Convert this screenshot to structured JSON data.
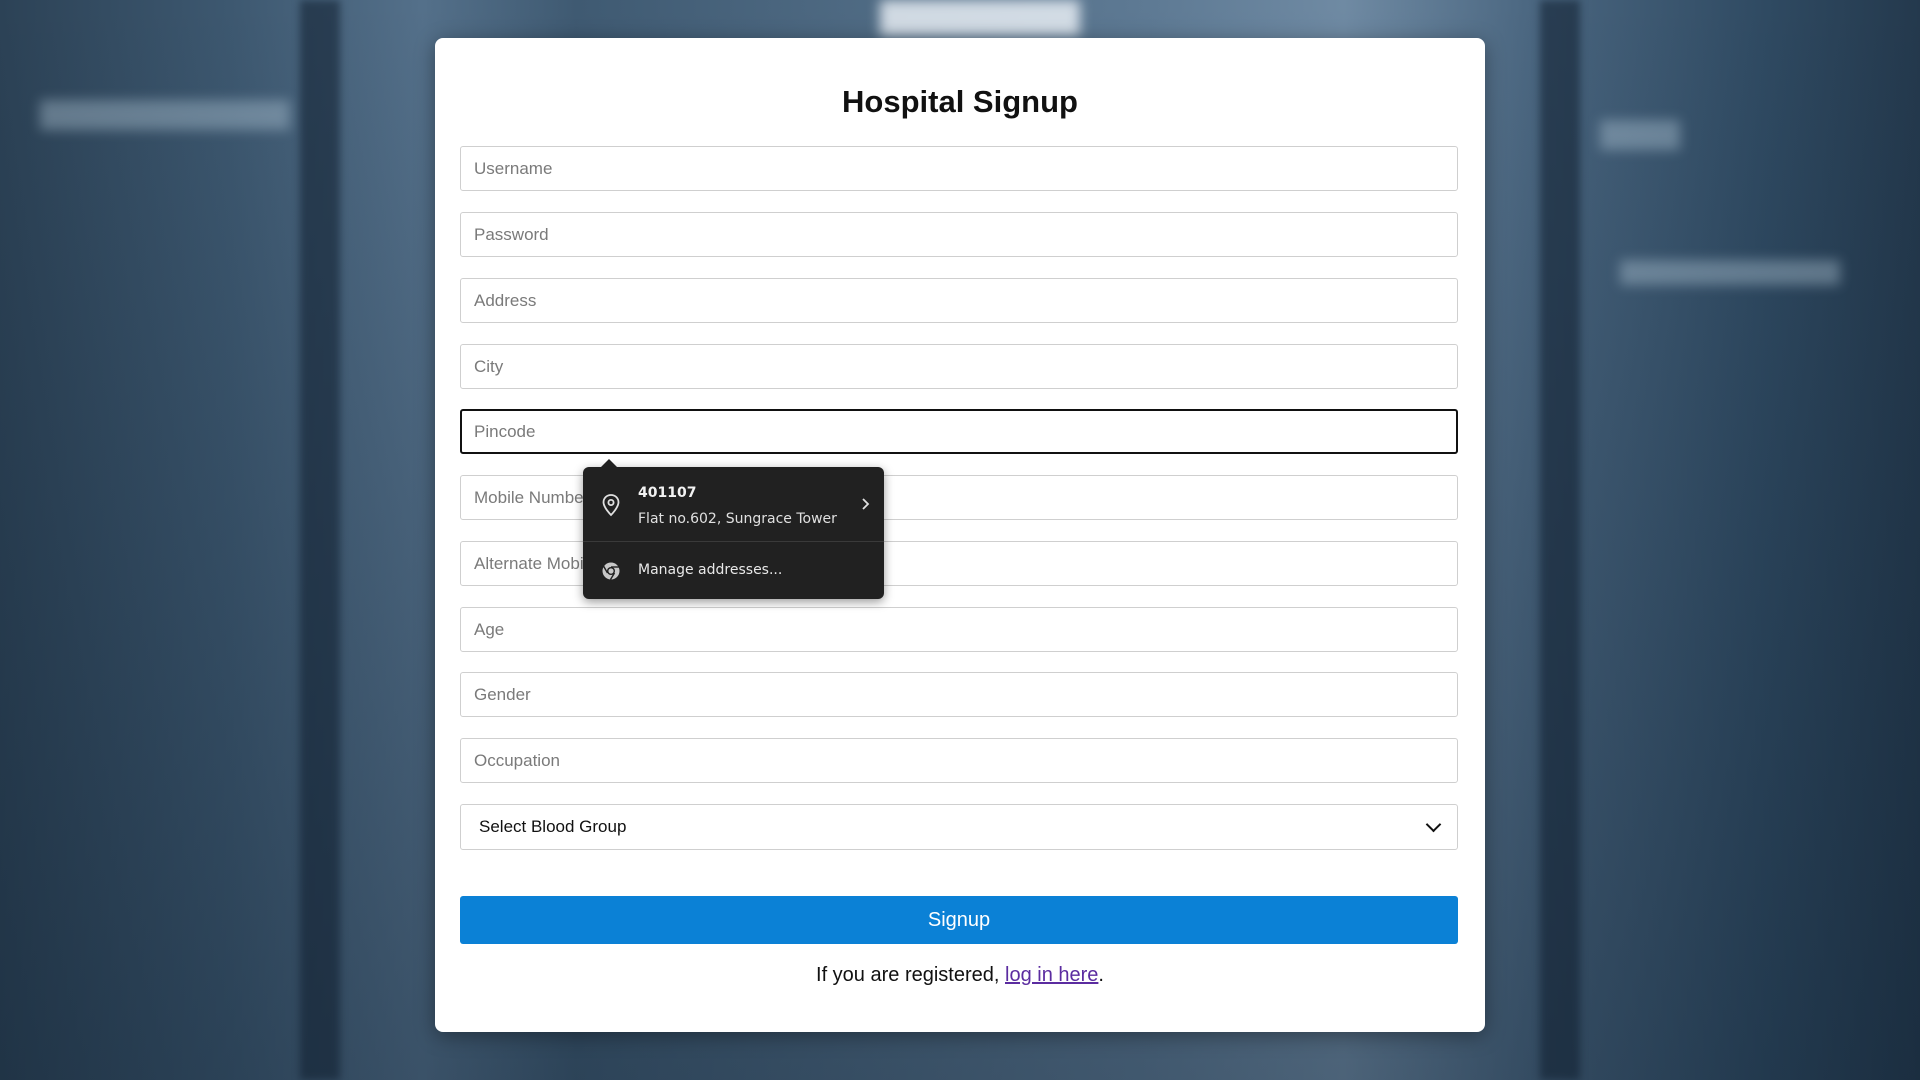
{
  "form": {
    "title": "Hospital Signup",
    "fields": [
      {
        "name": "username",
        "placeholder": "Username",
        "value": ""
      },
      {
        "name": "password",
        "placeholder": "Password",
        "value": ""
      },
      {
        "name": "address",
        "placeholder": "Address",
        "value": ""
      },
      {
        "name": "city",
        "placeholder": "City",
        "value": ""
      },
      {
        "name": "pincode",
        "placeholder": "Pincode",
        "value": ""
      },
      {
        "name": "mobile-number",
        "placeholder": "Mobile Number",
        "value": ""
      },
      {
        "name": "alternate-mobile",
        "placeholder": "Alternate Mobile Number",
        "value": ""
      },
      {
        "name": "age",
        "placeholder": "Age",
        "value": ""
      },
      {
        "name": "gender",
        "placeholder": "Gender",
        "value": ""
      },
      {
        "name": "occupation",
        "placeholder": "Occupation",
        "value": ""
      }
    ],
    "blood_group": {
      "selected": "Select Blood Group"
    },
    "signup_label": "Signup",
    "footer_prefix": "If you are registered, ",
    "footer_link": "log in here",
    "footer_suffix": "."
  },
  "autofill_popup": {
    "suggestion_title": "401107",
    "suggestion_subtitle": "Flat no.602, Sungrace Tower",
    "manage_label": "Manage addresses...",
    "icons": [
      "location-pin-icon",
      "chevron-right-icon",
      "chrome-icon"
    ]
  },
  "colors": {
    "signup_button": "#0b81d6",
    "link": "#5b2ca0",
    "popup_bg": "#212121"
  }
}
